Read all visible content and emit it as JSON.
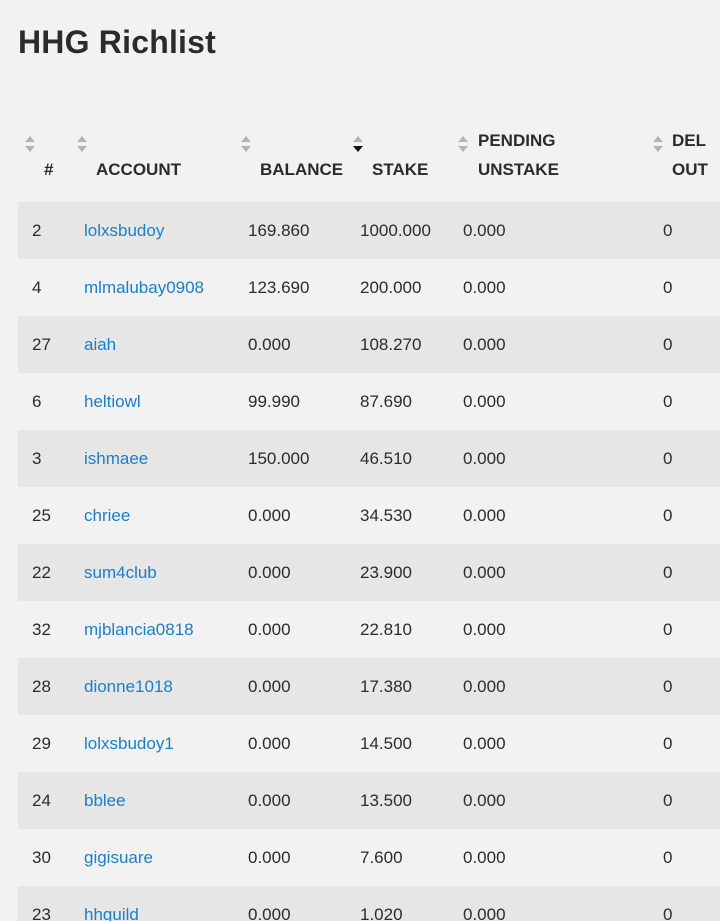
{
  "title": "HHG Richlist",
  "colors": {
    "link": "#1a7fc9",
    "row_odd": "#e6e6e6",
    "row_even": "#f2f2f2",
    "sort_inactive": "#b4b4b4",
    "sort_active": "#111111"
  },
  "icons": {
    "sort_inactive": "sort-both-icon",
    "sort_active": "sort-descending-icon"
  },
  "table": {
    "sorted_by": "STAKE",
    "sort_direction": "descending",
    "columns": [
      {
        "line1": "",
        "line2": "#"
      },
      {
        "line1": "",
        "line2": "ACCOUNT"
      },
      {
        "line1": "",
        "line2": "BALANCE"
      },
      {
        "line1": "",
        "line2": "STAKE"
      },
      {
        "line1": "PENDING",
        "line2": "UNSTAKE"
      },
      {
        "line1": "DEL",
        "line2": "OUT"
      }
    ],
    "rows": [
      {
        "rank": "2",
        "account": "lolxsbudoy",
        "balance": "169.860",
        "stake": "1000.000",
        "pending_unstake": "0.000",
        "delegated_out": "0"
      },
      {
        "rank": "4",
        "account": "mlmalubay0908",
        "balance": "123.690",
        "stake": "200.000",
        "pending_unstake": "0.000",
        "delegated_out": "0"
      },
      {
        "rank": "27",
        "account": "aiah",
        "balance": "0.000",
        "stake": "108.270",
        "pending_unstake": "0.000",
        "delegated_out": "0"
      },
      {
        "rank": "6",
        "account": "heltiowl",
        "balance": "99.990",
        "stake": "87.690",
        "pending_unstake": "0.000",
        "delegated_out": "0"
      },
      {
        "rank": "3",
        "account": "ishmaee",
        "balance": "150.000",
        "stake": "46.510",
        "pending_unstake": "0.000",
        "delegated_out": "0"
      },
      {
        "rank": "25",
        "account": "chriee",
        "balance": "0.000",
        "stake": "34.530",
        "pending_unstake": "0.000",
        "delegated_out": "0"
      },
      {
        "rank": "22",
        "account": "sum4club",
        "balance": "0.000",
        "stake": "23.900",
        "pending_unstake": "0.000",
        "delegated_out": "0"
      },
      {
        "rank": "32",
        "account": "mjblancia0818",
        "balance": "0.000",
        "stake": "22.810",
        "pending_unstake": "0.000",
        "delegated_out": "0"
      },
      {
        "rank": "28",
        "account": "dionne1018",
        "balance": "0.000",
        "stake": "17.380",
        "pending_unstake": "0.000",
        "delegated_out": "0"
      },
      {
        "rank": "29",
        "account": "lolxsbudoy1",
        "balance": "0.000",
        "stake": "14.500",
        "pending_unstake": "0.000",
        "delegated_out": "0"
      },
      {
        "rank": "24",
        "account": "bblee",
        "balance": "0.000",
        "stake": "13.500",
        "pending_unstake": "0.000",
        "delegated_out": "0"
      },
      {
        "rank": "30",
        "account": "gigisuare",
        "balance": "0.000",
        "stake": "7.600",
        "pending_unstake": "0.000",
        "delegated_out": "0"
      },
      {
        "rank": "23",
        "account": "hhguild",
        "balance": "0.000",
        "stake": "1.020",
        "pending_unstake": "0.000",
        "delegated_out": "0"
      }
    ]
  }
}
